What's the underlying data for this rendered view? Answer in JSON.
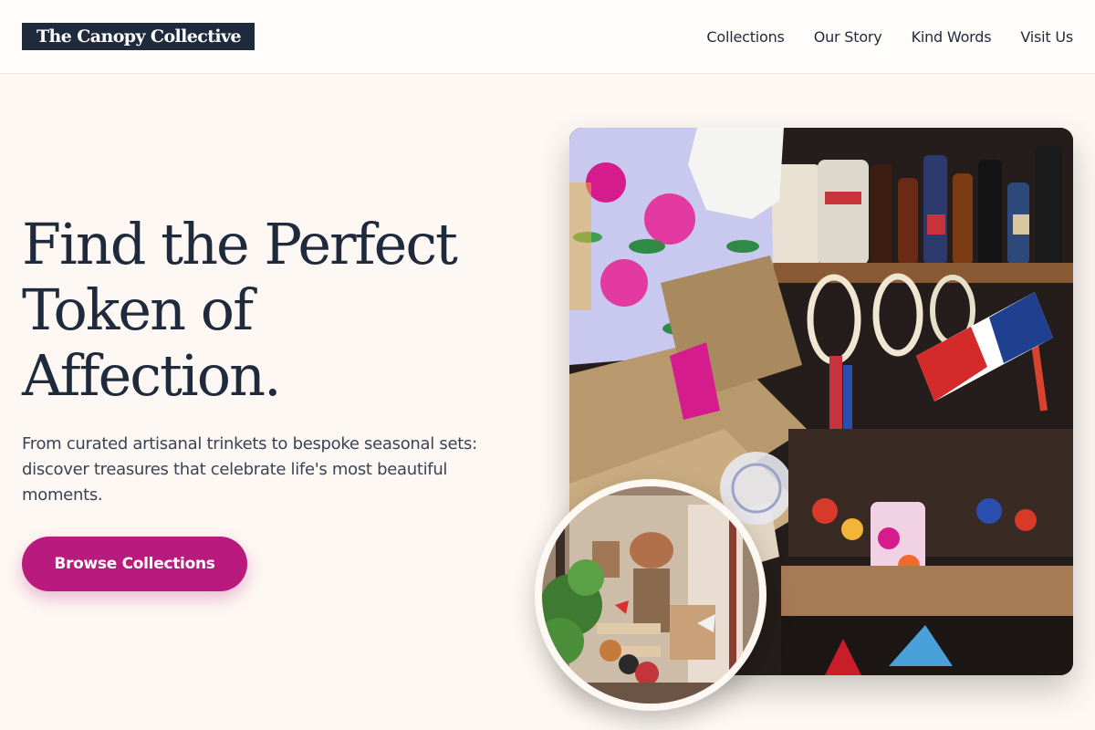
{
  "header": {
    "brand": "The Canopy Collective",
    "nav": [
      "Collections",
      "Our Story",
      "Kind Words",
      "Visit Us"
    ]
  },
  "hero": {
    "title": "Find the Perfect Token of Affection.",
    "subtitle": "From curated artisanal trinkets to bespoke seasonal sets: discover treasures that celebrate life's most beautiful moments.",
    "cta_label": "Browse Collections"
  },
  "images": {
    "main": "market-stall-photo",
    "inset": "storefront-window-photo"
  },
  "colors": {
    "accent": "#b81a7e",
    "brand_dark": "#1f2a3d",
    "background": "#fdf8f3"
  }
}
